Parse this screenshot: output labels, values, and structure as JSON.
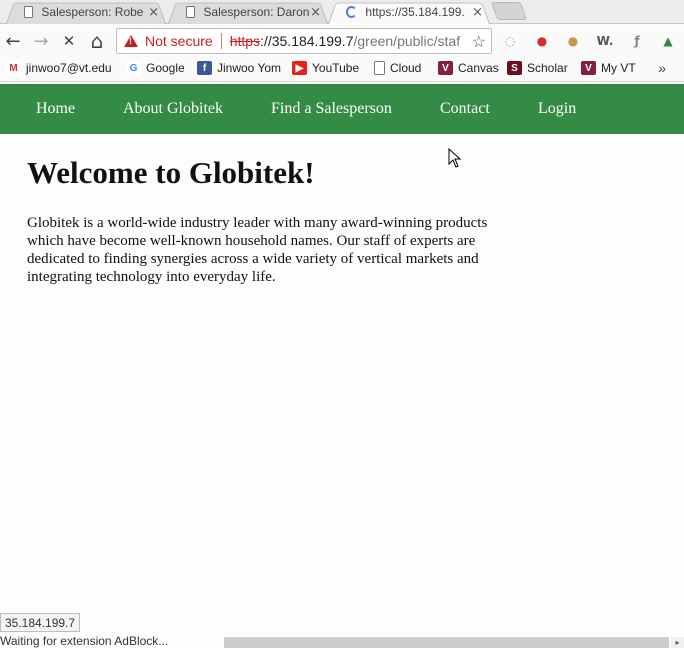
{
  "tabs": [
    {
      "title": "Salesperson: Robe",
      "close": "×"
    },
    {
      "title": "Salesperson: Daron",
      "close": "×"
    },
    {
      "title": "https://35.184.199.",
      "close": "×"
    }
  ],
  "toolbar": {
    "back_icon": "←",
    "forward_icon": "→",
    "stop_icon": "✕",
    "home_icon": "⌂",
    "security_label": "Not secure",
    "url_scheme": "https",
    "url_host": "://35.184.199.7",
    "url_path": "/green/public/staf",
    "star_icon": "☆",
    "extensions": [
      {
        "name": "circle-extension-icon",
        "glyph": "◌",
        "color": "#9a9a9a"
      },
      {
        "name": "adblock-icon",
        "glyph": "●",
        "color": "#d0312d"
      },
      {
        "name": "cookie-icon",
        "glyph": "●",
        "color": "#c9964a"
      },
      {
        "name": "wikiwand-icon",
        "glyph": "W.",
        "color": "#555555"
      },
      {
        "name": "flash-icon",
        "glyph": "ƒ",
        "color": "#888888"
      },
      {
        "name": "green-arrow-icon",
        "glyph": "▲",
        "color": "#2e8b3a"
      }
    ]
  },
  "bookmarks": [
    {
      "label": "jinwoo7@vt.edu",
      "icon": "gmail-icon",
      "glyph": "M",
      "bg": "#ffffff",
      "fg": "#d93025"
    },
    {
      "label": "Google",
      "icon": "google-icon",
      "glyph": "G",
      "bg": "#ffffff",
      "fg": "#4285f4"
    },
    {
      "label": "Jinwoo Yom",
      "icon": "facebook-icon",
      "glyph": "f",
      "bg": "#3b5998",
      "fg": "#ffffff"
    },
    {
      "label": "YouTube",
      "icon": "youtube-icon",
      "glyph": "▶",
      "bg": "#e62117",
      "fg": "#ffffff"
    },
    {
      "label": "Cloud",
      "icon": "page-icon",
      "glyph": "",
      "bg": "#ffffff",
      "fg": "#777777"
    },
    {
      "label": "Canvas",
      "icon": "vt-icon",
      "glyph": "V",
      "bg": "#861f41",
      "fg": "#ffffff"
    },
    {
      "label": "Scholar",
      "icon": "scholar-icon",
      "glyph": "S",
      "bg": "#6b0f1a",
      "fg": "#ffffff"
    },
    {
      "label": "My VT",
      "icon": "vt-icon",
      "glyph": "V",
      "bg": "#861f41",
      "fg": "#ffffff"
    }
  ],
  "bookmarks_more": "»",
  "site_nav": {
    "items": [
      "Home",
      "About Globitek",
      "Find a Salesperson",
      "Contact",
      "Login"
    ],
    "color": "#348b45"
  },
  "main": {
    "title": "Welcome to Globitek!",
    "intro": "Globitek is a world-wide industry leader with many award-winning products which have become well-known household names. Our staff of experts are dedicated to finding synergies across a wide variety of vertical markets and integrating technology into everyday life."
  },
  "status": {
    "url": "35.184.199.7",
    "message": "Waiting for extension AdBlock..."
  }
}
